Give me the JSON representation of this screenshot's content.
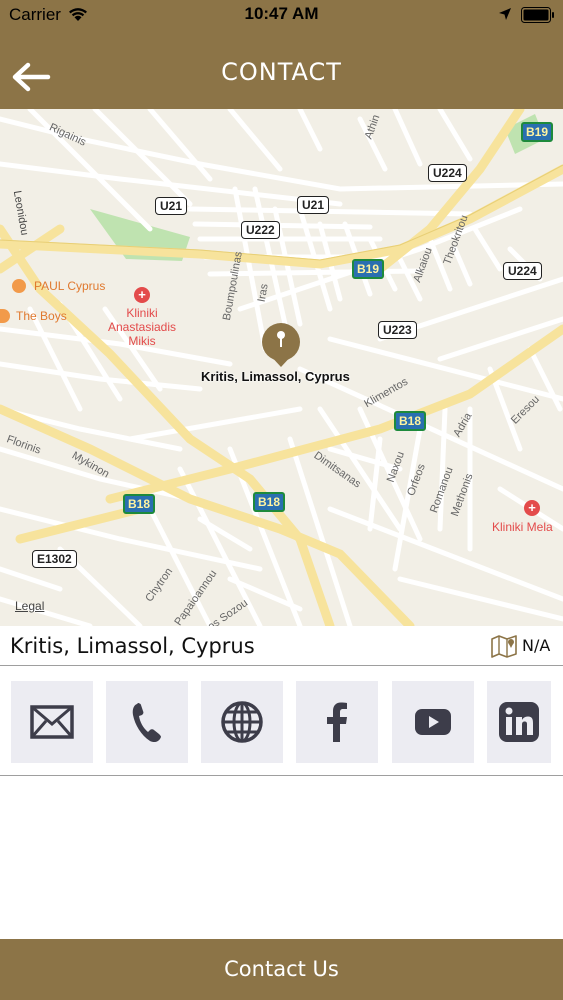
{
  "status_bar": {
    "carrier": "Carrier",
    "time": "10:47 AM"
  },
  "nav": {
    "title": "CONTACT",
    "back_icon": "arrow-left-icon"
  },
  "map": {
    "pin_label": "Kritis, Limassol, Cyprus",
    "legal": "Legal",
    "places": {
      "paul_cyprus": "PAUL Cyprus",
      "the_boys": "The Boys",
      "kliniki_1": "Kliniki",
      "anastasiadis": "Anastasiadis",
      "mikis": "Mikis",
      "kliniki_mela": "Kliniki Mela"
    },
    "streets": {
      "rigainis": "Rigainis",
      "leonidou": "Leonidou",
      "athin": "Athin",
      "boumpoulinas": "Boumpoulinas",
      "iras": "Iras",
      "alkaiou": "Alkaiou",
      "theokritou": "Theokritou",
      "klimentos": "Klimentos",
      "florinis": "Florinis",
      "mykinon": "Mykinon",
      "dimitsanas": "Dimitsanas",
      "naxou": "Naxou",
      "orfeos": "Orfeos",
      "romanou": "Romanou",
      "methonis": "Methonis",
      "adria": "Adria",
      "eresou": "Eresou",
      "chytron": "Chytron",
      "papaioannou": "kia Papaioannou",
      "sozou": "os Sozou"
    },
    "shields": {
      "b19_top": "B19",
      "u224_top": "U224",
      "u21_left": "U21",
      "u21_right": "U21",
      "u222": "U222",
      "b19_mid": "B19",
      "u224_right": "U224",
      "u223": "U223",
      "b18_right": "B18",
      "b18_left": "B18",
      "b18_mid": "B18",
      "e1302": "E1302"
    },
    "colors": {
      "land": "#f2efe6",
      "road": "#ffffff",
      "major_road": "#f7e39c",
      "park": "#bfe3b0",
      "pin": "#8c7447"
    }
  },
  "address": {
    "text": "Kritis, Limassol, Cyprus",
    "distance": "N/A",
    "map_icon": "folded-map-icon"
  },
  "social": {
    "items": [
      {
        "name": "email",
        "icon": "envelope-icon"
      },
      {
        "name": "phone",
        "icon": "phone-icon"
      },
      {
        "name": "website",
        "icon": "globe-icon"
      },
      {
        "name": "facebook",
        "icon": "facebook-icon"
      },
      {
        "name": "youtube",
        "icon": "youtube-icon"
      },
      {
        "name": "linkedin",
        "icon": "linkedin-icon"
      }
    ]
  },
  "footer": {
    "label": "Contact Us"
  },
  "colors": {
    "brand": "#8c7447",
    "tile_bg": "#ececf2",
    "icon": "#3d3d4a"
  }
}
